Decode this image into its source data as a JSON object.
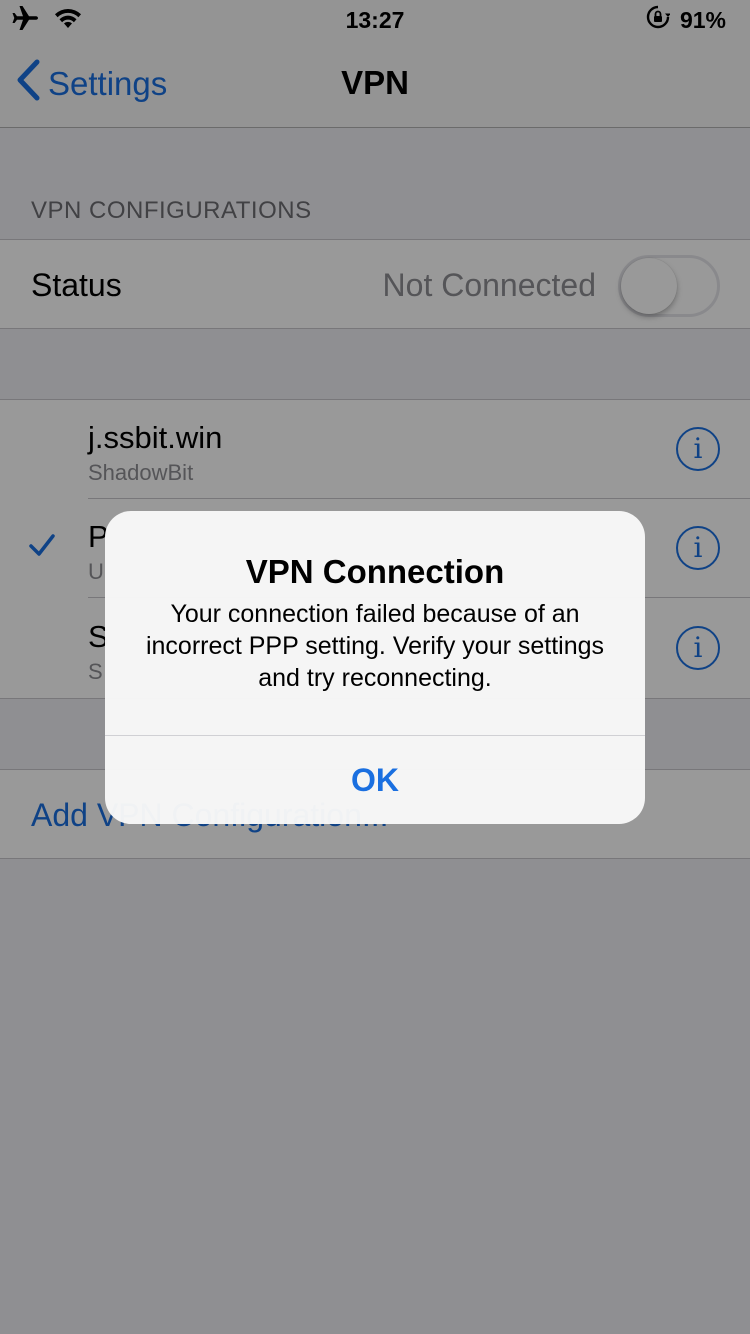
{
  "status_bar": {
    "time": "13:27",
    "battery": "91%",
    "icons": [
      "airplane-icon",
      "wifi-icon",
      "orientation-lock-icon"
    ]
  },
  "nav": {
    "back_label": "Settings",
    "title": "VPN"
  },
  "section_header": "VPN CONFIGURATIONS",
  "status_row": {
    "label": "Status",
    "value": "Not Connected",
    "toggle_on": false
  },
  "vpn_configs": [
    {
      "name": "j.ssbit.win",
      "subtitle": "ShadowBit",
      "selected": false
    },
    {
      "name": "P",
      "subtitle": "U",
      "selected": true
    },
    {
      "name": "S",
      "subtitle": "S",
      "selected": false
    }
  ],
  "add_config_label": "Add VPN Configuration...",
  "alert": {
    "title": "VPN Connection",
    "message": "Your connection failed because of an incorrect PPP setting. Verify your settings and try reconnecting.",
    "button": "OK"
  },
  "colors": {
    "accent": "#1a6fe0",
    "background": "#efeff4",
    "secondary_text": "#8e8e93"
  }
}
